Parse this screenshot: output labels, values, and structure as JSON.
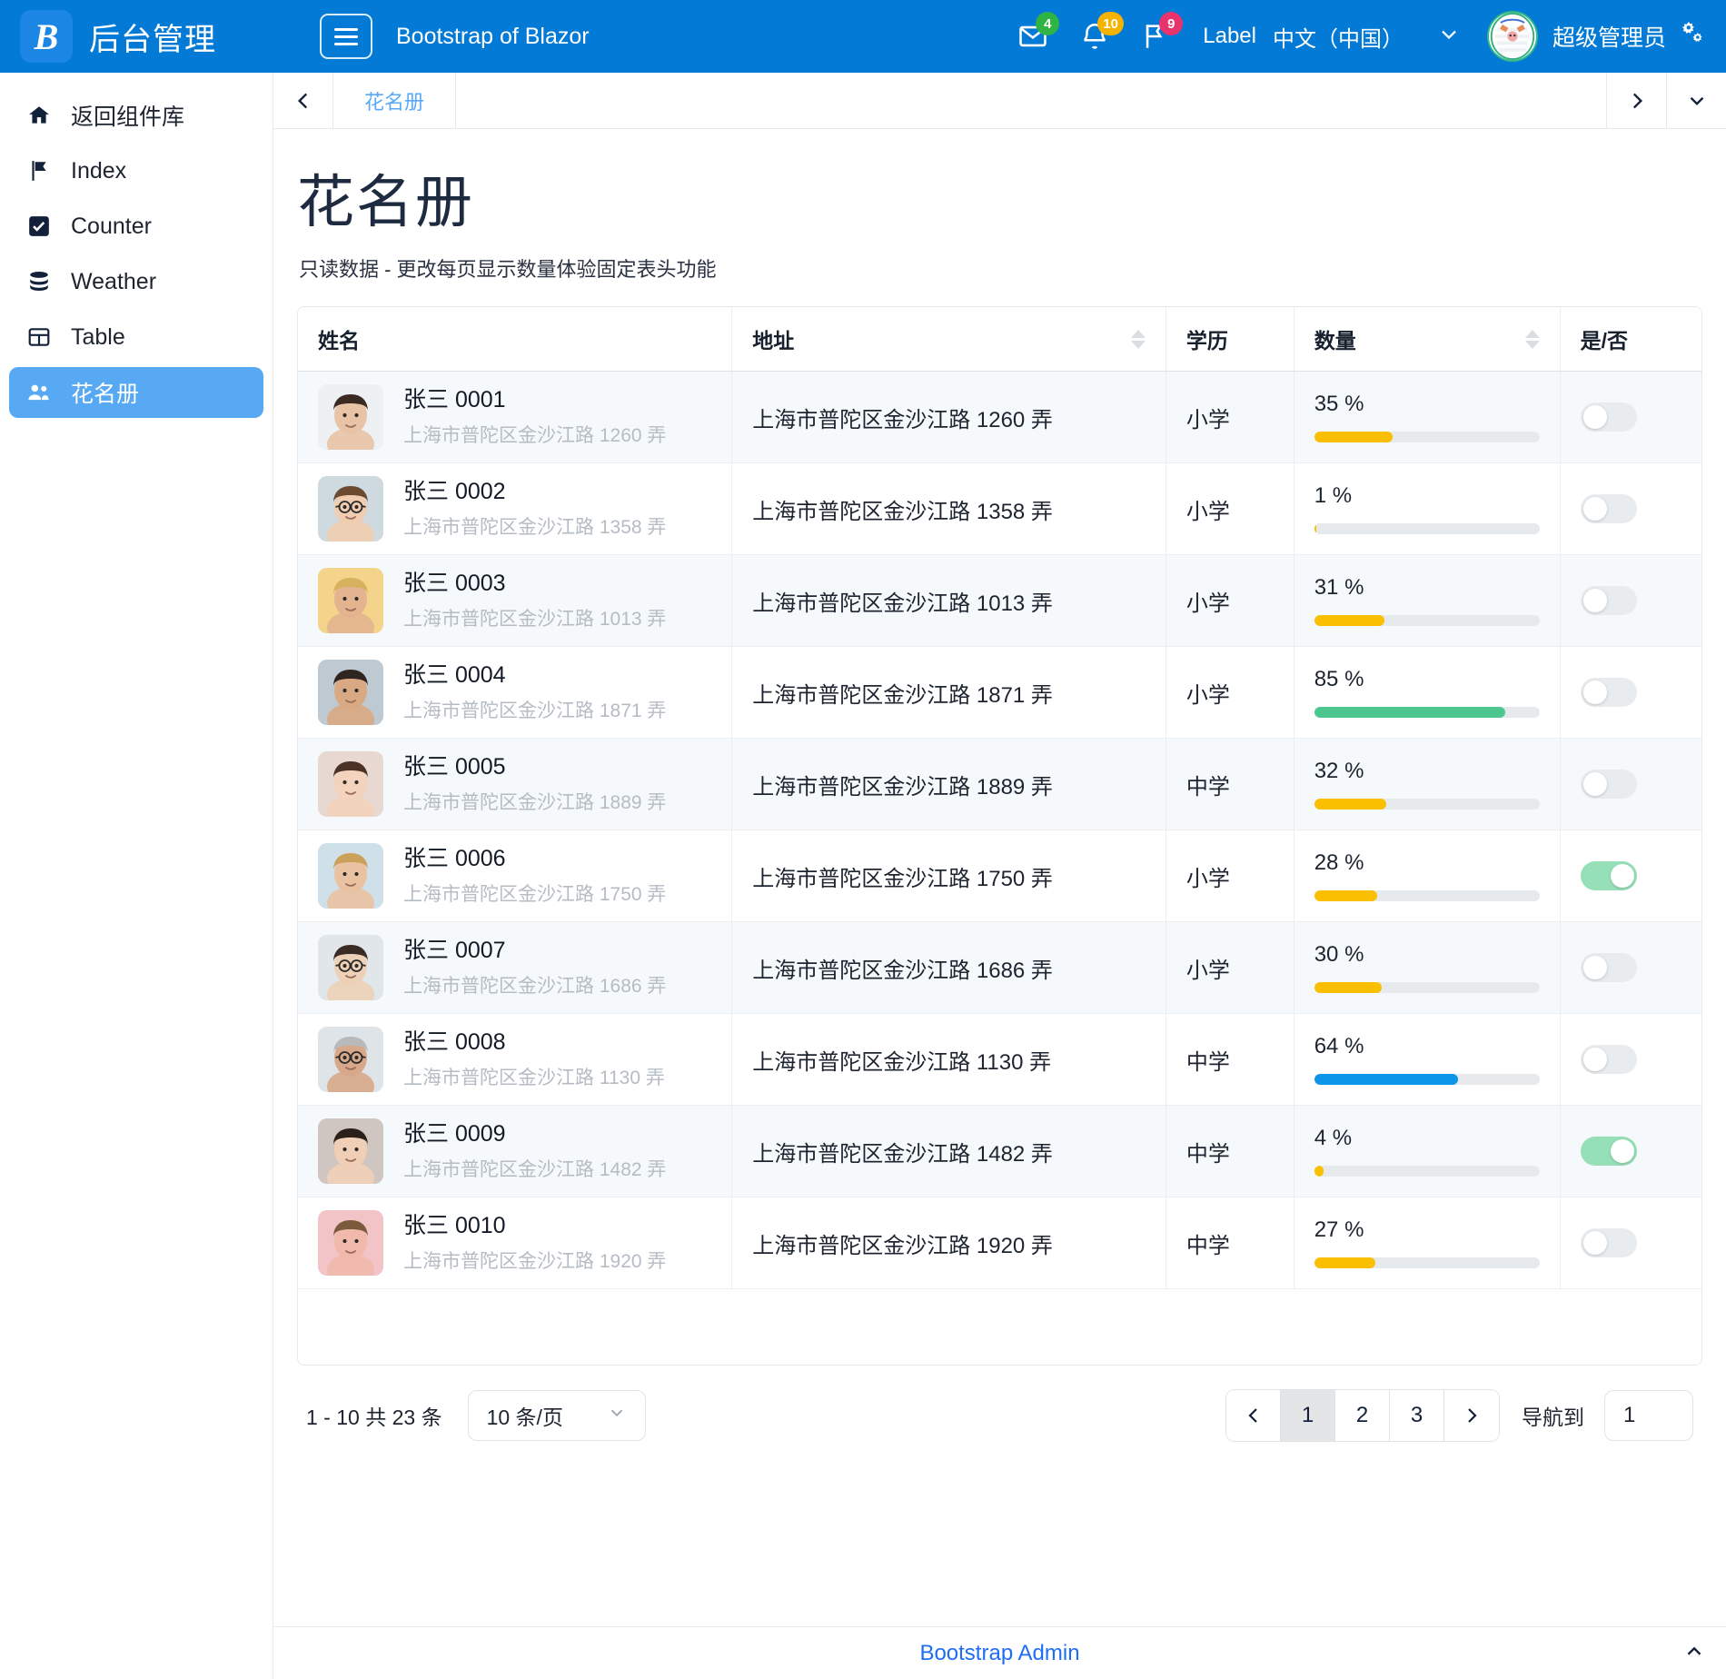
{
  "navbar": {
    "brand_logo": "B",
    "brand_title": "后台管理",
    "menu_icon": "hamburger-icon",
    "app_title": "Bootstrap of Blazor",
    "notifications": [
      {
        "icon": "envelope-icon",
        "count": "4",
        "color": "#2fb344"
      },
      {
        "icon": "bell-icon",
        "count": "10",
        "color": "#f5b301"
      },
      {
        "icon": "flag-icon",
        "count": "9",
        "color": "#e8336d"
      }
    ],
    "label": "Label",
    "language": "中文（中国）",
    "caret_icon": "chevron-down-icon",
    "user_name": "超级管理员",
    "settings_icon": "gears-icon"
  },
  "sidebar": {
    "items": [
      {
        "label": "返回组件库",
        "icon": "home-icon",
        "active": false
      },
      {
        "label": "Index",
        "icon": "flag-icon",
        "active": false
      },
      {
        "label": "Counter",
        "icon": "check-square-icon",
        "active": false
      },
      {
        "label": "Weather",
        "icon": "database-icon",
        "active": false
      },
      {
        "label": "Table",
        "icon": "table-icon",
        "active": false
      },
      {
        "label": "花名册",
        "icon": "people-icon",
        "active": true
      }
    ],
    "active_color": "#56a9f2"
  },
  "tabbar": {
    "prev_icon": "chevron-left-icon",
    "tabs": [
      {
        "label": "花名册",
        "active": true
      }
    ],
    "next_icon": "chevron-right-icon",
    "dropdown_icon": "chevron-down-icon"
  },
  "page": {
    "title": "花名册",
    "subtitle": "只读数据 - 更改每页显示数量体验固定表头功能"
  },
  "table": {
    "columns": [
      {
        "label": "姓名",
        "sortable": false
      },
      {
        "label": "地址",
        "sortable": true
      },
      {
        "label": "学历",
        "sortable": false
      },
      {
        "label": "数量",
        "sortable": true
      },
      {
        "label": "是/否",
        "sortable": false
      }
    ],
    "rows": [
      {
        "name": "张三 0001",
        "sub_address": "上海市普陀区金沙江路 1260 弄",
        "address": "上海市普陀区金沙江路 1260 弄",
        "education": "小学",
        "count": "35 %",
        "percent": 35,
        "bar_color": "#f9bf00",
        "toggle": false
      },
      {
        "name": "张三 0002",
        "sub_address": "上海市普陀区金沙江路 1358 弄",
        "address": "上海市普陀区金沙江路 1358 弄",
        "education": "小学",
        "count": "1 %",
        "percent": 1,
        "bar_color": "#f9bf00",
        "toggle": false
      },
      {
        "name": "张三 0003",
        "sub_address": "上海市普陀区金沙江路 1013 弄",
        "address": "上海市普陀区金沙江路 1013 弄",
        "education": "小学",
        "count": "31 %",
        "percent": 31,
        "bar_color": "#f9bf00",
        "toggle": false
      },
      {
        "name": "张三 0004",
        "sub_address": "上海市普陀区金沙江路 1871 弄",
        "address": "上海市普陀区金沙江路 1871 弄",
        "education": "小学",
        "count": "85 %",
        "percent": 85,
        "bar_color": "#4cc790",
        "toggle": false
      },
      {
        "name": "张三 0005",
        "sub_address": "上海市普陀区金沙江路 1889 弄",
        "address": "上海市普陀区金沙江路 1889 弄",
        "education": "中学",
        "count": "32 %",
        "percent": 32,
        "bar_color": "#f9bf00",
        "toggle": false
      },
      {
        "name": "张三 0006",
        "sub_address": "上海市普陀区金沙江路 1750 弄",
        "address": "上海市普陀区金沙江路 1750 弄",
        "education": "小学",
        "count": "28 %",
        "percent": 28,
        "bar_color": "#f9bf00",
        "toggle": true
      },
      {
        "name": "张三 0007",
        "sub_address": "上海市普陀区金沙江路 1686 弄",
        "address": "上海市普陀区金沙江路 1686 弄",
        "education": "小学",
        "count": "30 %",
        "percent": 30,
        "bar_color": "#f9bf00",
        "toggle": false
      },
      {
        "name": "张三 0008",
        "sub_address": "上海市普陀区金沙江路 1130 弄",
        "address": "上海市普陀区金沙江路 1130 弄",
        "education": "中学",
        "count": "64 %",
        "percent": 64,
        "bar_color": "#0d96e8",
        "toggle": false
      },
      {
        "name": "张三 0009",
        "sub_address": "上海市普陀区金沙江路 1482 弄",
        "address": "上海市普陀区金沙江路 1482 弄",
        "education": "中学",
        "count": "4 %",
        "percent": 4,
        "bar_color": "#f9bf00",
        "toggle": true
      },
      {
        "name": "张三 0010",
        "sub_address": "上海市普陀区金沙江路 1920 弄",
        "address": "上海市普陀区金沙江路 1920 弄",
        "education": "中学",
        "count": "27 %",
        "percent": 27,
        "bar_color": "#f9bf00",
        "toggle": false
      }
    ]
  },
  "pagination": {
    "info": "1 - 10 共 23 条",
    "page_size": "10 条/页",
    "page_size_caret": "chevron-down-icon",
    "prev_icon": "chevron-left-icon",
    "pages": [
      "1",
      "2",
      "3"
    ],
    "active_page": "1",
    "next_icon": "chevron-right-icon",
    "goto_label": "导航到",
    "goto_value": "1"
  },
  "footer": {
    "link": "Bootstrap Admin",
    "to_top_icon": "chevron-up-icon"
  }
}
